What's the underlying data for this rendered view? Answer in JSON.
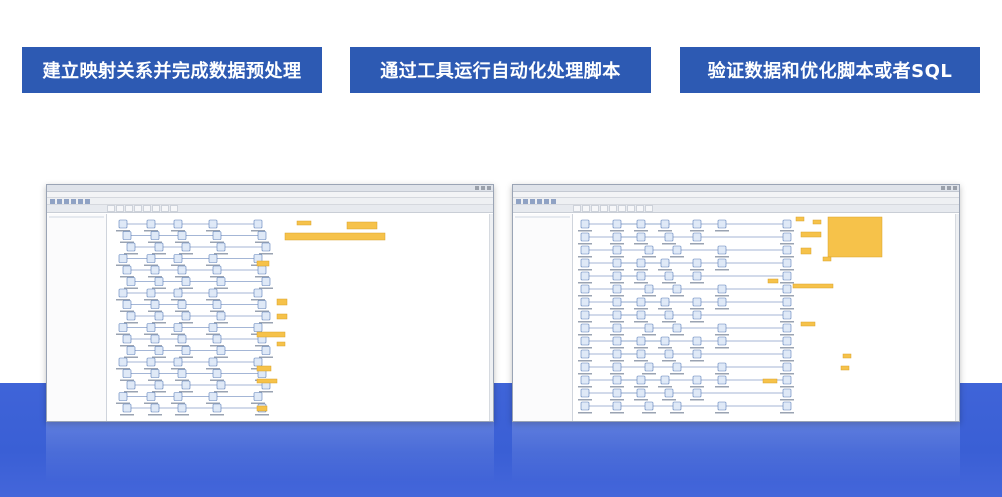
{
  "banners": [
    "建立映射关系并完成数据预处理",
    "通过工具运行自动化处理脚本",
    "验证数据和优化脚本或者SQL"
  ],
  "colors": {
    "banner_bg": "#2d5ab3",
    "bottom_band": "#3f64d8",
    "note_bg": "#f6c24a"
  },
  "icons": {
    "node": "transform-step-icon",
    "arrow": "flow-arrow-icon"
  }
}
